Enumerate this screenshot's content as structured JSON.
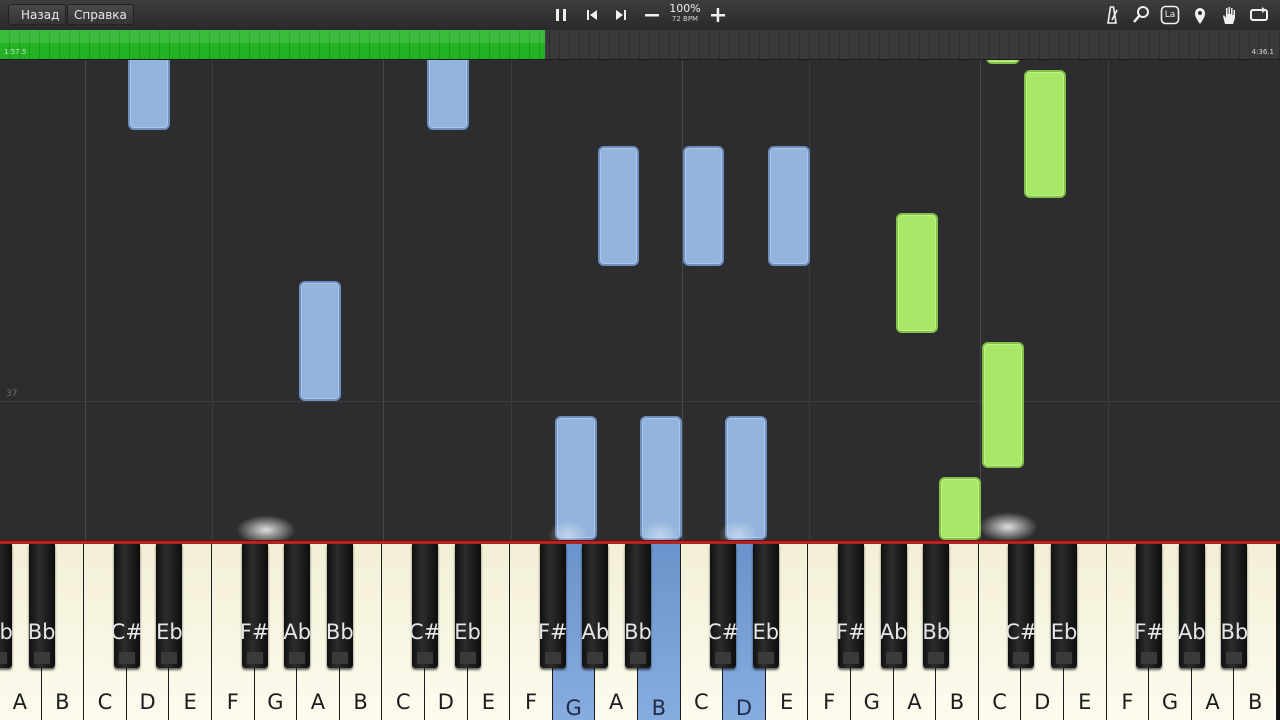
{
  "toolbar": {
    "back_label": "Назад",
    "help_label": "Справка",
    "tempo_percent": "100%",
    "tempo_bpm": "72 BPM",
    "icons": [
      "pause-icon",
      "skip-back-icon",
      "skip-forward-icon",
      "minus-icon",
      "plus-icon"
    ],
    "right_icons": [
      "metronome-icon",
      "magnifier-icon",
      "label-mode-icon",
      "location-pin-icon",
      "hand-icon",
      "loop-icon"
    ],
    "label_icon_text": "La"
  },
  "timeline": {
    "elapsed": "1:57.5",
    "total": "4:36.1",
    "progress_fraction": 0.426
  },
  "roll": {
    "measure_label": "37"
  },
  "keyboard": {
    "white_keys": [
      "A",
      "B",
      "C",
      "D",
      "E",
      "F",
      "G",
      "A",
      "B",
      "C",
      "D",
      "E",
      "F",
      "G",
      "A",
      "B",
      "C",
      "D",
      "E",
      "F",
      "G",
      "A",
      "B",
      "C",
      "D",
      "E",
      "F",
      "G",
      "A",
      "B"
    ],
    "black_keys": [
      {
        "label": "Bb",
        "after": -1,
        "active": false
      },
      {
        "label": "Bb",
        "after": 0,
        "active": false
      },
      {
        "label": "C#",
        "after": 2,
        "active": false
      },
      {
        "label": "Eb",
        "after": 3,
        "active": false
      },
      {
        "label": "F#",
        "after": 5,
        "active": false
      },
      {
        "label": "Ab",
        "after": 6,
        "active": false
      },
      {
        "label": "Bb",
        "after": 7,
        "active": false
      },
      {
        "label": "C#",
        "after": 9,
        "active": false
      },
      {
        "label": "Eb",
        "after": 10,
        "active": false
      },
      {
        "label": "F#",
        "after": 12,
        "active": false
      },
      {
        "label": "Ab",
        "after": 13,
        "active": false
      },
      {
        "label": "Bb",
        "after": 14,
        "active": false
      },
      {
        "label": "C#",
        "after": 16,
        "active": false
      },
      {
        "label": "Eb",
        "after": 17,
        "active": false
      },
      {
        "label": "F#",
        "after": 19,
        "active": false
      },
      {
        "label": "Ab",
        "after": 20,
        "active": false
      },
      {
        "label": "Bb",
        "after": 21,
        "active": false
      },
      {
        "label": "C#",
        "after": 23,
        "active": false
      },
      {
        "label": "Eb",
        "after": 24,
        "active": false
      },
      {
        "label": "F#",
        "after": 26,
        "active": false
      },
      {
        "label": "Ab",
        "after": 27,
        "active": false
      },
      {
        "label": "Bb",
        "after": 28,
        "active": false
      }
    ],
    "active_white": [
      13,
      15,
      17
    ]
  }
}
